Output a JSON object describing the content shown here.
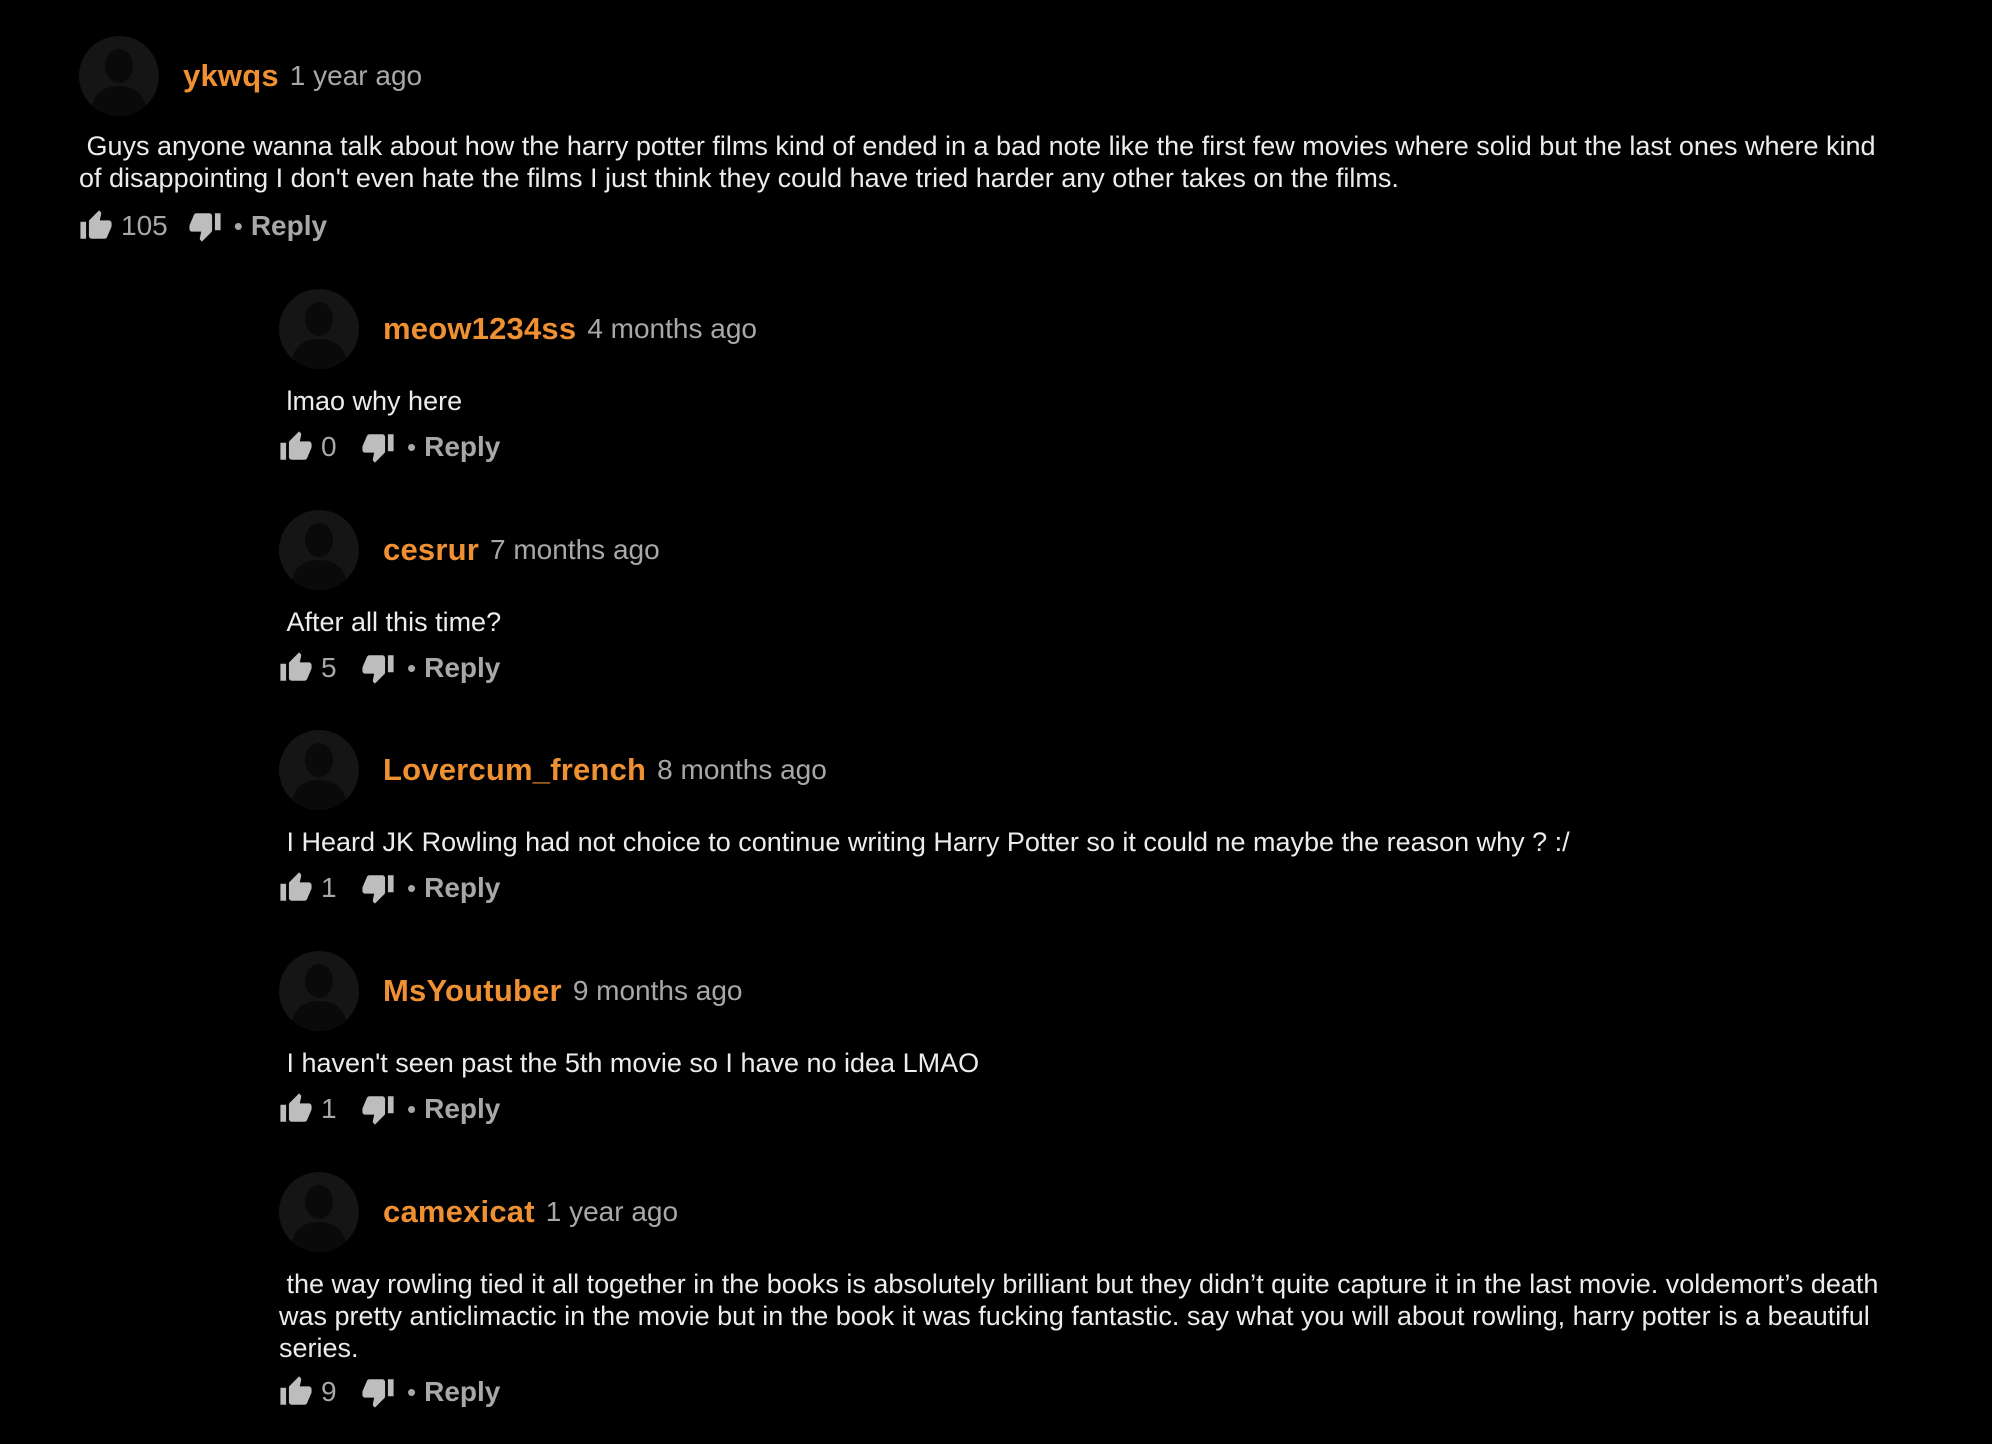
{
  "reply_label": "Reply",
  "bullet": "•",
  "colors": {
    "background": "#000000",
    "username": "#ef9132",
    "meta": "#a8a8a8",
    "body": "#ececec"
  },
  "comments": [
    {
      "username": "ykwqs",
      "time": "1 year ago",
      "text": " Guys anyone wanna talk about how the harry potter films kind of ended in a bad note like the first few movies where solid but the last ones where kind of disappointing I don't even hate the films I just think they could have tried harder any other takes on the films.",
      "likes": "105"
    },
    {
      "username": "meow1234ss",
      "time": "4 months ago",
      "text": " lmao why here",
      "likes": "0"
    },
    {
      "username": "cesrur",
      "time": "7 months ago",
      "text": " After all this time?",
      "likes": "5"
    },
    {
      "username": "Lovercum_french",
      "time": "8 months ago",
      "text": " I Heard JK Rowling had not choice to continue writing Harry Potter so it could ne maybe the reason why ? :/",
      "likes": "1"
    },
    {
      "username": "MsYoutuber",
      "time": "9 months ago",
      "text": " I haven't seen past the 5th movie so I have no idea LMAO",
      "likes": "1"
    },
    {
      "username": "camexicat",
      "time": "1 year ago",
      "text": " the way rowling tied it all together in the books is absolutely brilliant but they didn’t quite capture it in the last movie. voldemort’s death was pretty anticlimactic in the movie but in the book it was fucking fantastic. say what you will about rowling, harry potter is a beautiful series.",
      "likes": "9"
    }
  ]
}
